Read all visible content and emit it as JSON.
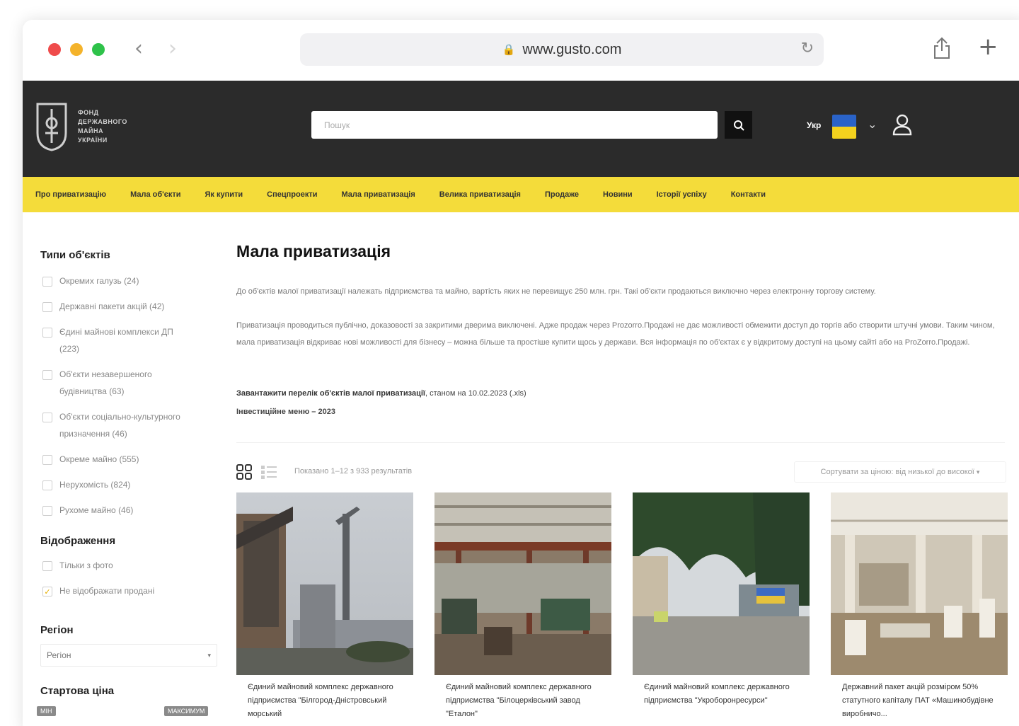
{
  "browser": {
    "url": "www.gusto.com"
  },
  "header": {
    "logo_text": "ФОНД ДЕРЖАВНОГО МАЙНА УКРАЇНИ",
    "search_placeholder": "Пошук",
    "lang": "Укр"
  },
  "nav": [
    "Про приватизацію",
    "Мала об'єкти",
    "Як купити",
    "Спецпроекти",
    "Мала приватизація",
    "Велика приватизація",
    "Продаже",
    "Новини",
    "Історії успіху",
    "Контакти"
  ],
  "sidebar": {
    "types_title": "Типи об'єктів",
    "types": [
      {
        "label": "Окремих галузь (24)",
        "checked": false
      },
      {
        "label": "Державні пакети акцій (42)",
        "checked": false
      },
      {
        "label": "Єдині майнові комплекси ДП (223)",
        "checked": false
      },
      {
        "label": "Об'єкти незавершеного будівництва (63)",
        "checked": false
      },
      {
        "label": "Об'єкти соціально-культурного призначення (46)",
        "checked": false
      },
      {
        "label": "Окреме майно (555)",
        "checked": false
      },
      {
        "label": "Нерухомість (824)",
        "checked": false
      },
      {
        "label": "Рухоме майно (46)",
        "checked": false
      }
    ],
    "display_title": "Відображення",
    "display": [
      {
        "label": "Тільки з фото",
        "checked": false
      },
      {
        "label": "Не відображати продані",
        "checked": true
      }
    ],
    "region_title": "Регіон",
    "region_value": "Регіон",
    "price_title": "Стартова ціна",
    "price_min": "МІН",
    "price_max": "МАКСИМУМ"
  },
  "main": {
    "title": "Мала приватизація",
    "para1": "До об'єктів малої приватизації належать підприємства та майно, вартість яких не перевищує 250 млн. грн. Такі об'єкти продаються виключно через електронну торгову систему.",
    "para2": "Приватизація проводиться публічно, доказовості за закритими дверима виключені. Адже продаж через Prozorro.Продажі не дає можливості обмежити доступ до торгів або створити штучні умови. Таким чином, мала приватизація відкриває нові можливості для бізнесу – можна більше та простіше купити щось у держави. Вся інформація по об'єктах є у відкритому доступі на цьому сайті або на ProZorro.Продажі.",
    "download_bold": "Завантажити перелік об'єктів малої приватизації",
    "download_rest": ", станом на 10.02.2023 (.xls)",
    "invest_menu": "Інвестиційне меню – 2023",
    "results": "Показано 1–12 з 933 результатів",
    "sort": "Сортувати за ціною: від низької до високої"
  },
  "cards": [
    {
      "title": "Єдиний майновий комплекс державного підприємства \"Білгород-Дністровський морський"
    },
    {
      "title": "Єдиний майновий комплекс державного підприємства \"Білоцерківський завод \"Еталон\""
    },
    {
      "title": "Єдиний майновий комплекс державного підприємства \"Укроборонресурси\""
    },
    {
      "title": "Державний пакет акцій розміром 50% статутного капіталу ПАТ «Машинобудівне виробничо..."
    }
  ],
  "colors": {
    "header_bg": "#2b2b2b",
    "nav_bg": "#f4dc3a",
    "flag_blue": "#2a63c8",
    "flag_yellow": "#f4d21e"
  }
}
